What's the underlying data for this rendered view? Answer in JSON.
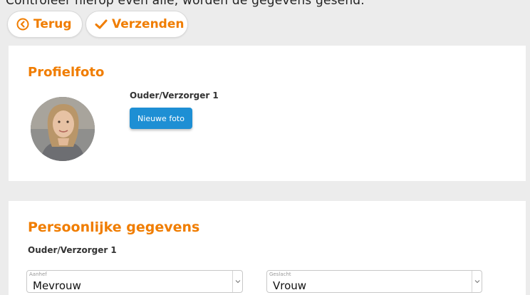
{
  "top_cut_text": "Controleer hierop even alle, worden de gegevens gesend.",
  "toolbar": {
    "back_label": "Terug",
    "send_label": "Verzenden"
  },
  "profile": {
    "title": "Profielfoto",
    "parent_label": "Ouder/Verzorger 1",
    "new_photo_label": "Nieuwe foto"
  },
  "personal": {
    "title": "Persoonlijke gegevens",
    "parent_label": "Ouder/Verzorger 1",
    "fields": [
      {
        "label": "Aanhef",
        "value": "Mevrouw"
      },
      {
        "label": "Geslacht",
        "value": "Vrouw"
      }
    ]
  },
  "colors": {
    "accent": "#f07d00",
    "button_blue": "#1e8fd4",
    "background": "#ececec"
  },
  "icons": {
    "back": "circle-chevron-left-icon",
    "send": "check-icon",
    "dropdown": "chevron-down-icon"
  }
}
